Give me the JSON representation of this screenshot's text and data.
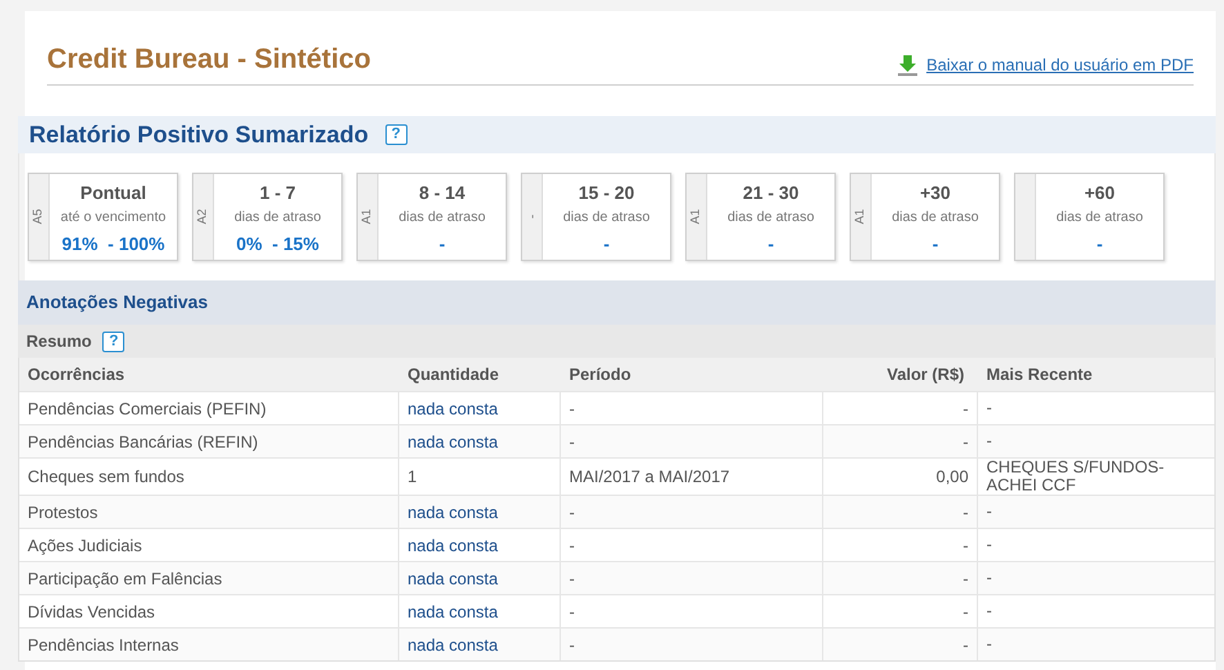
{
  "header": {
    "title": "Credit Bureau - Sintético",
    "manual_link": "Baixar o manual do usuário em PDF"
  },
  "positive_report": {
    "title": "Relatório Positivo Sumarizado",
    "help": "?",
    "cards": [
      {
        "tag": "A5",
        "range": "Pontual",
        "caption": "até o vencimento",
        "value": "91%  - 100%"
      },
      {
        "tag": "A2",
        "range": "1 - 7",
        "caption": "dias de atraso",
        "value": "0%  - 15%"
      },
      {
        "tag": "A1",
        "range": "8 - 14",
        "caption": "dias de atraso",
        "value": "-"
      },
      {
        "tag": "-",
        "range": "15 - 20",
        "caption": "dias de atraso",
        "value": "-"
      },
      {
        "tag": "A1",
        "range": "21 - 30",
        "caption": "dias de atraso",
        "value": "-"
      },
      {
        "tag": "A1",
        "range": "+30",
        "caption": "dias de atraso",
        "value": "-"
      },
      {
        "range": "+60",
        "caption": "dias de atraso",
        "value": "-"
      }
    ]
  },
  "negative": {
    "title": "Anotações Negativas",
    "summary_title": "Resumo",
    "help": "?",
    "table": {
      "columns": [
        "Ocorrências",
        "Quantidade",
        "Período",
        "Valor (R$)",
        "Mais Recente"
      ],
      "rows": [
        [
          "Pendências Comerciais (PEFIN)",
          "nada consta",
          "-",
          "-",
          "-"
        ],
        [
          "Pendências Bancárias (REFIN)",
          "nada consta",
          "-",
          "-",
          "-"
        ],
        [
          "Cheques sem fundos",
          "1",
          "MAI/2017 a MAI/2017",
          "0,00",
          "CHEQUES S/FUNDOS-ACHEI CCF"
        ],
        [
          "Protestos",
          "nada consta",
          "-",
          "-",
          "-"
        ],
        [
          "Ações Judiciais",
          "nada consta",
          "-",
          "-",
          "-"
        ],
        [
          "Participação em Falências",
          "nada consta",
          "-",
          "-",
          "-"
        ],
        [
          "Dívidas Vencidas",
          "nada consta",
          "-",
          "-",
          "-"
        ],
        [
          "Pendências Internas",
          "nada consta",
          "-",
          "-",
          "-"
        ]
      ]
    }
  }
}
